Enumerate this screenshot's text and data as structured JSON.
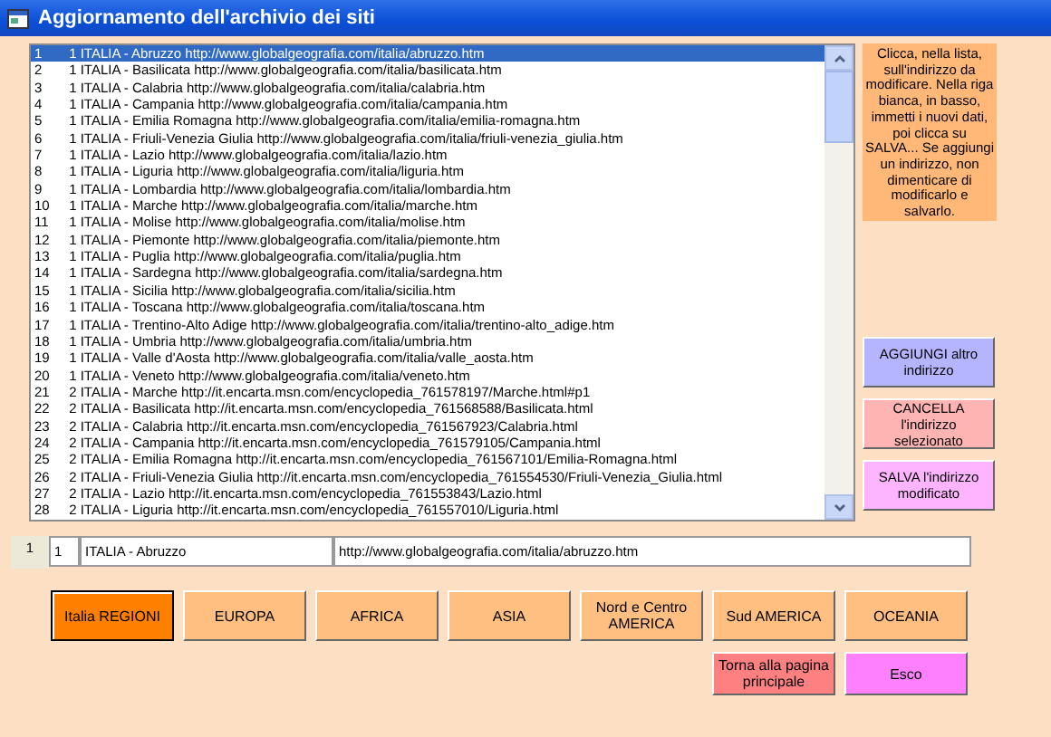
{
  "window": {
    "title": "Aggiornamento dell'archivio dei siti"
  },
  "list": {
    "rows": [
      {
        "num": "1",
        "text": "1 ITALIA - Abruzzo http://www.globalgeografia.com/italia/abruzzo.htm",
        "selected": true
      },
      {
        "num": "2",
        "text": "1 ITALIA - Basilicata http://www.globalgeografia.com/italia/basilicata.htm",
        "selected": false
      },
      {
        "num": "3",
        "text": "1 ITALIA - Calabria http://www.globalgeografia.com/italia/calabria.htm",
        "selected": false
      },
      {
        "num": "4",
        "text": "1 ITALIA - Campania http://www.globalgeografia.com/italia/campania.htm",
        "selected": false
      },
      {
        "num": "5",
        "text": "1 ITALIA - Emilia Romagna http://www.globalgeografia.com/italia/emilia-romagna.htm",
        "selected": false
      },
      {
        "num": "6",
        "text": "1 ITALIA - Friuli-Venezia Giulia http://www.globalgeografia.com/italia/friuli-venezia_giulia.htm",
        "selected": false
      },
      {
        "num": "7",
        "text": "1 ITALIA - Lazio http://www.globalgeografia.com/italia/lazio.htm",
        "selected": false
      },
      {
        "num": "8",
        "text": "1 ITALIA - Liguria http://www.globalgeografia.com/italia/liguria.htm",
        "selected": false
      },
      {
        "num": "9",
        "text": "1 ITALIA - Lombardia http://www.globalgeografia.com/italia/lombardia.htm",
        "selected": false
      },
      {
        "num": "10",
        "text": "1 ITALIA - Marche http://www.globalgeografia.com/italia/marche.htm",
        "selected": false
      },
      {
        "num": "11",
        "text": "1 ITALIA - Molise http://www.globalgeografia.com/italia/molise.htm",
        "selected": false
      },
      {
        "num": "12",
        "text": "1 ITALIA - Piemonte http://www.globalgeografia.com/italia/piemonte.htm",
        "selected": false
      },
      {
        "num": "13",
        "text": "1 ITALIA - Puglia http://www.globalgeografia.com/italia/puglia.htm",
        "selected": false
      },
      {
        "num": "14",
        "text": "1 ITALIA - Sardegna http://www.globalgeografia.com/italia/sardegna.htm",
        "selected": false
      },
      {
        "num": "15",
        "text": "1 ITALIA - Sicilia http://www.globalgeografia.com/italia/sicilia.htm",
        "selected": false
      },
      {
        "num": "16",
        "text": "1 ITALIA - Toscana http://www.globalgeografia.com/italia/toscana.htm",
        "selected": false
      },
      {
        "num": "17",
        "text": "1 ITALIA - Trentino-Alto Adige http://www.globalgeografia.com/italia/trentino-alto_adige.htm",
        "selected": false
      },
      {
        "num": "18",
        "text": "1 ITALIA - Umbria http://www.globalgeografia.com/italia/umbria.htm",
        "selected": false
      },
      {
        "num": "19",
        "text": "1 ITALIA - Valle d'Aosta http://www.globalgeografia.com/italia/valle_aosta.htm",
        "selected": false
      },
      {
        "num": "20",
        "text": "1 ITALIA - Veneto http://www.globalgeografia.com/italia/veneto.htm",
        "selected": false
      },
      {
        "num": "21",
        "text": "2 ITALIA - Marche http://it.encarta.msn.com/encyclopedia_761578197/Marche.html#p1",
        "selected": false
      },
      {
        "num": "22",
        "text": "2 ITALIA - Basilicata http://it.encarta.msn.com/encyclopedia_761568588/Basilicata.html",
        "selected": false
      },
      {
        "num": "23",
        "text": "2 ITALIA - Calabria http://it.encarta.msn.com/encyclopedia_761567923/Calabria.html",
        "selected": false
      },
      {
        "num": "24",
        "text": "2 ITALIA - Campania http://it.encarta.msn.com/encyclopedia_761579105/Campania.html",
        "selected": false
      },
      {
        "num": "25",
        "text": "2 ITALIA - Emilia Romagna http://it.encarta.msn.com/encyclopedia_761567101/Emilia-Romagna.html",
        "selected": false
      },
      {
        "num": "26",
        "text": "2 ITALIA - Friuli-Venezia Giulia http://it.encarta.msn.com/encyclopedia_761554530/Friuli-Venezia_Giulia.html",
        "selected": false
      },
      {
        "num": "27",
        "text": "2 ITALIA - Lazio http://it.encarta.msn.com/encyclopedia_761553843/Lazio.html",
        "selected": false
      },
      {
        "num": "28",
        "text": "2 ITALIA - Liguria http://it.encarta.msn.com/encyclopedia_761557010/Liguria.html",
        "selected": false
      }
    ]
  },
  "note": "Clicca, nella lista, sull'indirizzo da modificare. Nella riga bianca, in basso, immetti i nuovi dati, poi clicca su SALVA... Se aggiungi un indirizzo, non dimenticare di modificarlo e salvarlo.",
  "side_buttons": [
    {
      "label": "AGGIUNGI altro indirizzo",
      "kind": "add"
    },
    {
      "label": "CANCELLA l'indirizzo selezionato",
      "kind": "delete"
    },
    {
      "label": "SALVA l'indirizzo modificato",
      "kind": "save"
    }
  ],
  "editor": {
    "record": "1",
    "fields": [
      {
        "value": "1"
      },
      {
        "value": "ITALIA - Abruzzo"
      },
      {
        "value": "http://www.globalgeografia.com/italia/abruzzo.htm"
      }
    ]
  },
  "nav_buttons": [
    {
      "label": "Italia REGIONI",
      "selected": true
    },
    {
      "label": "EUROPA",
      "selected": false
    },
    {
      "label": "AFRICA",
      "selected": false
    },
    {
      "label": "ASIA",
      "selected": false
    },
    {
      "label": "Nord e Centro AMERICA",
      "selected": false
    },
    {
      "label": "Sud AMERICA",
      "selected": false
    },
    {
      "label": "OCEANIA",
      "selected": false
    }
  ],
  "footer_buttons": [
    {
      "label": "Torna alla pagina principale",
      "kind": "home"
    },
    {
      "label": "Esco",
      "kind": "exit"
    }
  ]
}
